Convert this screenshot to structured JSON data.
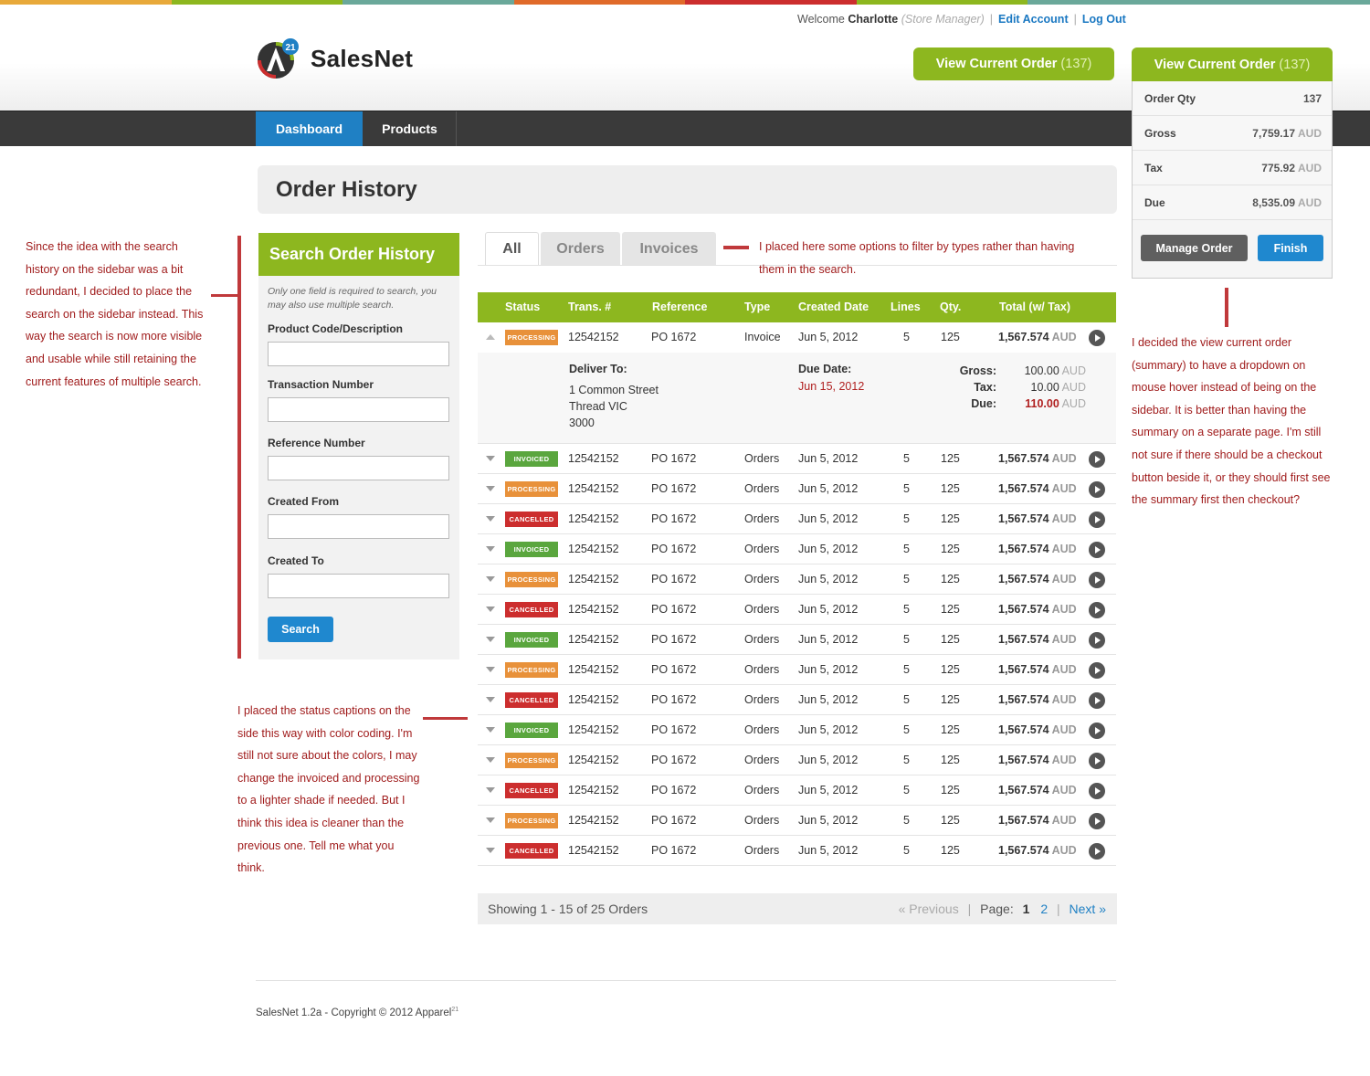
{
  "colors": {
    "green": "#8db71f",
    "blue": "#1f80c4",
    "processing": "#e8913a",
    "invoiced": "#5aa63e",
    "cancelled": "#cc2e2e",
    "annotation": "#a01c1c"
  },
  "stripe": [
    "#e8a93a",
    "#8db71f",
    "#6aa89a",
    "#e06a2a",
    "#cc2e2e",
    "#8db71f",
    "#6aa89a",
    "#6aa89a"
  ],
  "header": {
    "welcome_prefix": "Welcome",
    "user": "Charlotte",
    "role": "(Store Manager)",
    "edit_account": "Edit Account",
    "logout": "Log Out",
    "logo_text": "SalesNet",
    "logo_badge": "21",
    "vco_label": "View Current Order",
    "vco_count": "(137)"
  },
  "nav": {
    "dashboard": "Dashboard",
    "products": "Products"
  },
  "summary": {
    "head_label": "View Current Order",
    "head_count": "(137)",
    "rows": [
      {
        "label": "Order Qty",
        "value": "137",
        "unit": ""
      },
      {
        "label": "Gross",
        "value": "7,759.17",
        "unit": "AUD"
      },
      {
        "label": "Tax",
        "value": "775.92",
        "unit": "AUD"
      },
      {
        "label": "Due",
        "value": "8,535.09",
        "unit": "AUD"
      }
    ],
    "manage": "Manage Order",
    "finish": "Finish"
  },
  "page_title": "Order History",
  "search": {
    "title": "Search Order History",
    "note": "Only one field is required to search, you may also use multiple search.",
    "fields": [
      "Product Code/Description",
      "Transaction Number",
      "Reference Number",
      "Created From",
      "Created To"
    ],
    "button": "Search"
  },
  "tabs": [
    "All",
    "Orders",
    "Invoices"
  ],
  "table": {
    "headers": [
      "Status",
      "Trans. #",
      "Reference",
      "Type",
      "Created Date",
      "Lines",
      "Qty.",
      "Total (w/ Tax)"
    ],
    "rows": [
      {
        "status": "PROCESSING",
        "trans": "12542152",
        "ref": "PO 1672",
        "type": "Invoice",
        "date": "Jun 5, 2012",
        "lines": "5",
        "qty": "125",
        "total": "1,567.574",
        "unit": "AUD"
      },
      {
        "status": "INVOICED",
        "trans": "12542152",
        "ref": "PO 1672",
        "type": "Orders",
        "date": "Jun 5, 2012",
        "lines": "5",
        "qty": "125",
        "total": "1,567.574",
        "unit": "AUD"
      },
      {
        "status": "PROCESSING",
        "trans": "12542152",
        "ref": "PO 1672",
        "type": "Orders",
        "date": "Jun 5, 2012",
        "lines": "5",
        "qty": "125",
        "total": "1,567.574",
        "unit": "AUD"
      },
      {
        "status": "CANCELLED",
        "trans": "12542152",
        "ref": "PO 1672",
        "type": "Orders",
        "date": "Jun 5, 2012",
        "lines": "5",
        "qty": "125",
        "total": "1,567.574",
        "unit": "AUD"
      },
      {
        "status": "INVOICED",
        "trans": "12542152",
        "ref": "PO 1672",
        "type": "Orders",
        "date": "Jun 5, 2012",
        "lines": "5",
        "qty": "125",
        "total": "1,567.574",
        "unit": "AUD"
      },
      {
        "status": "PROCESSING",
        "trans": "12542152",
        "ref": "PO 1672",
        "type": "Orders",
        "date": "Jun 5, 2012",
        "lines": "5",
        "qty": "125",
        "total": "1,567.574",
        "unit": "AUD"
      },
      {
        "status": "CANCELLED",
        "trans": "12542152",
        "ref": "PO 1672",
        "type": "Orders",
        "date": "Jun 5, 2012",
        "lines": "5",
        "qty": "125",
        "total": "1,567.574",
        "unit": "AUD"
      },
      {
        "status": "INVOICED",
        "trans": "12542152",
        "ref": "PO 1672",
        "type": "Orders",
        "date": "Jun 5, 2012",
        "lines": "5",
        "qty": "125",
        "total": "1,567.574",
        "unit": "AUD"
      },
      {
        "status": "PROCESSING",
        "trans": "12542152",
        "ref": "PO 1672",
        "type": "Orders",
        "date": "Jun 5, 2012",
        "lines": "5",
        "qty": "125",
        "total": "1,567.574",
        "unit": "AUD"
      },
      {
        "status": "CANCELLED",
        "trans": "12542152",
        "ref": "PO 1672",
        "type": "Orders",
        "date": "Jun 5, 2012",
        "lines": "5",
        "qty": "125",
        "total": "1,567.574",
        "unit": "AUD"
      },
      {
        "status": "INVOICED",
        "trans": "12542152",
        "ref": "PO 1672",
        "type": "Orders",
        "date": "Jun 5, 2012",
        "lines": "5",
        "qty": "125",
        "total": "1,567.574",
        "unit": "AUD"
      },
      {
        "status": "PROCESSING",
        "trans": "12542152",
        "ref": "PO 1672",
        "type": "Orders",
        "date": "Jun 5, 2012",
        "lines": "5",
        "qty": "125",
        "total": "1,567.574",
        "unit": "AUD"
      },
      {
        "status": "CANCELLED",
        "trans": "12542152",
        "ref": "PO 1672",
        "type": "Orders",
        "date": "Jun 5, 2012",
        "lines": "5",
        "qty": "125",
        "total": "1,567.574",
        "unit": "AUD"
      },
      {
        "status": "PROCESSING",
        "trans": "12542152",
        "ref": "PO 1672",
        "type": "Orders",
        "date": "Jun 5, 2012",
        "lines": "5",
        "qty": "125",
        "total": "1,567.574",
        "unit": "AUD"
      },
      {
        "status": "CANCELLED",
        "trans": "12542152",
        "ref": "PO 1672",
        "type": "Orders",
        "date": "Jun 5, 2012",
        "lines": "5",
        "qty": "125",
        "total": "1,567.574",
        "unit": "AUD"
      }
    ]
  },
  "detail": {
    "deliver_label": "Deliver To:",
    "address": [
      "1 Common Street",
      "Thread VIC",
      "3000"
    ],
    "due_date_label": "Due Date:",
    "due_date": "Jun 15, 2012",
    "gross_label": "Gross:",
    "gross": "100.00",
    "tax_label": "Tax:",
    "tax": "10.00",
    "due_label": "Due:",
    "due": "110.00",
    "unit": "AUD"
  },
  "pager": {
    "showing": "Showing 1 - 15 of 25 Orders",
    "previous": "« Previous",
    "page_label": "Page:",
    "pages": [
      "1",
      "2"
    ],
    "next": "Next »"
  },
  "annotations": {
    "left": [
      "Since the idea with the search",
      "history on the sidebar was a bit",
      "redundant, I decided to place the",
      "search on the sidebar instead. This",
      "way the search is now more visible",
      "and usable while still retaining the",
      "current features of multiple search."
    ],
    "tabs": [
      "I placed here some options to filter by types rather than having",
      "them in the search."
    ],
    "right": [
      "I decided the view current order",
      "(summary) to have a dropdown  on",
      "mouse hover instead of being on the",
      "sidebar. It is better than having the",
      "summary on a separate page. I'm still",
      "not sure if there should be a checkout",
      "button beside it, or they should first see",
      "the summary first then checkout?"
    ],
    "status": [
      "I placed the status captions on the",
      "side this way with color coding. I'm",
      "still not sure about the colors, I may",
      "change the invoiced and processing",
      "to a lighter shade if needed.  But I",
      "think this idea is cleaner than the",
      "previous one. Tell me what you",
      "think."
    ]
  },
  "footer": {
    "copyright": "SalesNet 1.2a - Copyright © 2012 Apparel",
    "sup": "21"
  }
}
